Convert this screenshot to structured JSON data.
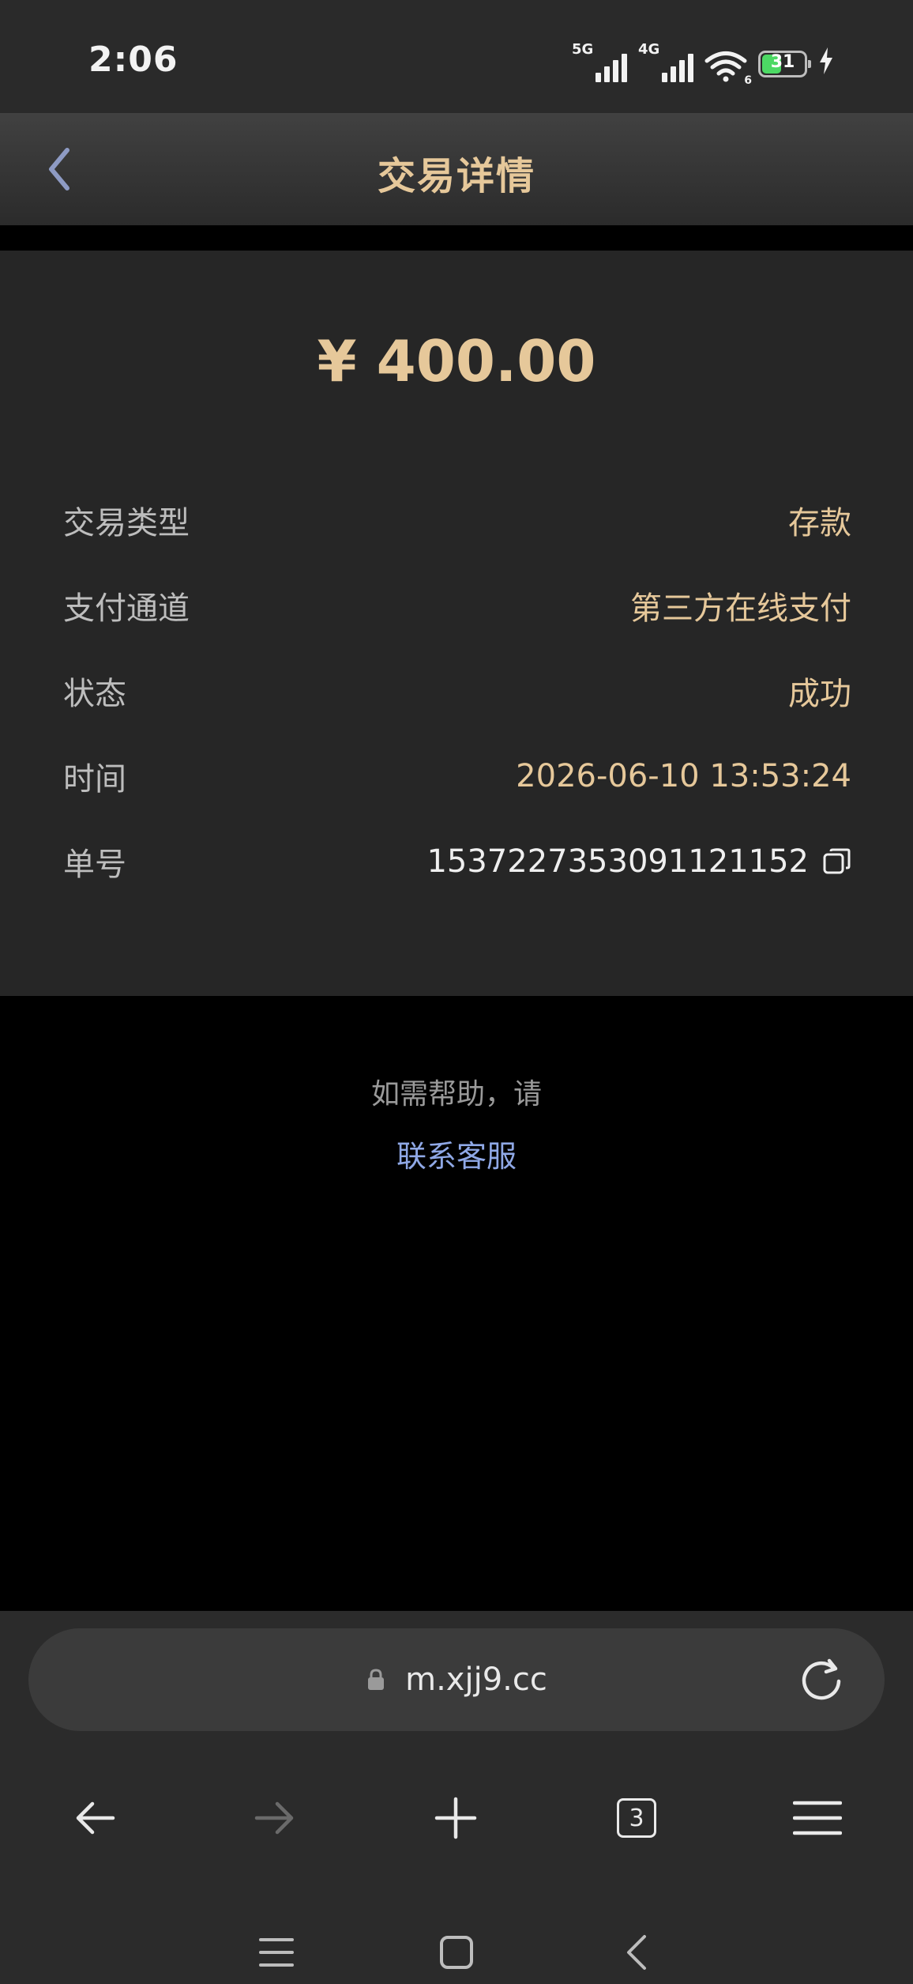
{
  "status_bar": {
    "time": "2:06",
    "network_1": "5G",
    "network_2": "4G",
    "wifi_label": "6",
    "battery": "31"
  },
  "header": {
    "title": "交易详情"
  },
  "detail": {
    "amount": "¥ 400.00",
    "rows": [
      {
        "label": "交易类型",
        "value": "存款"
      },
      {
        "label": "支付通道",
        "value": "第三方在线支付"
      },
      {
        "label": "状态",
        "value": "成功"
      },
      {
        "label": "时间",
        "value": "2026-06-10 13:53:24"
      },
      {
        "label": "单号",
        "value": "1537227353091121152"
      }
    ]
  },
  "help": {
    "text": "如需帮助，请",
    "link": "联系客服"
  },
  "browser": {
    "url": "m.xjj9.cc",
    "tab_count": "3"
  },
  "colors": {
    "accent_gold": "#e6c89a",
    "link_blue": "#8fa8e6",
    "card_bg": "#262626"
  }
}
